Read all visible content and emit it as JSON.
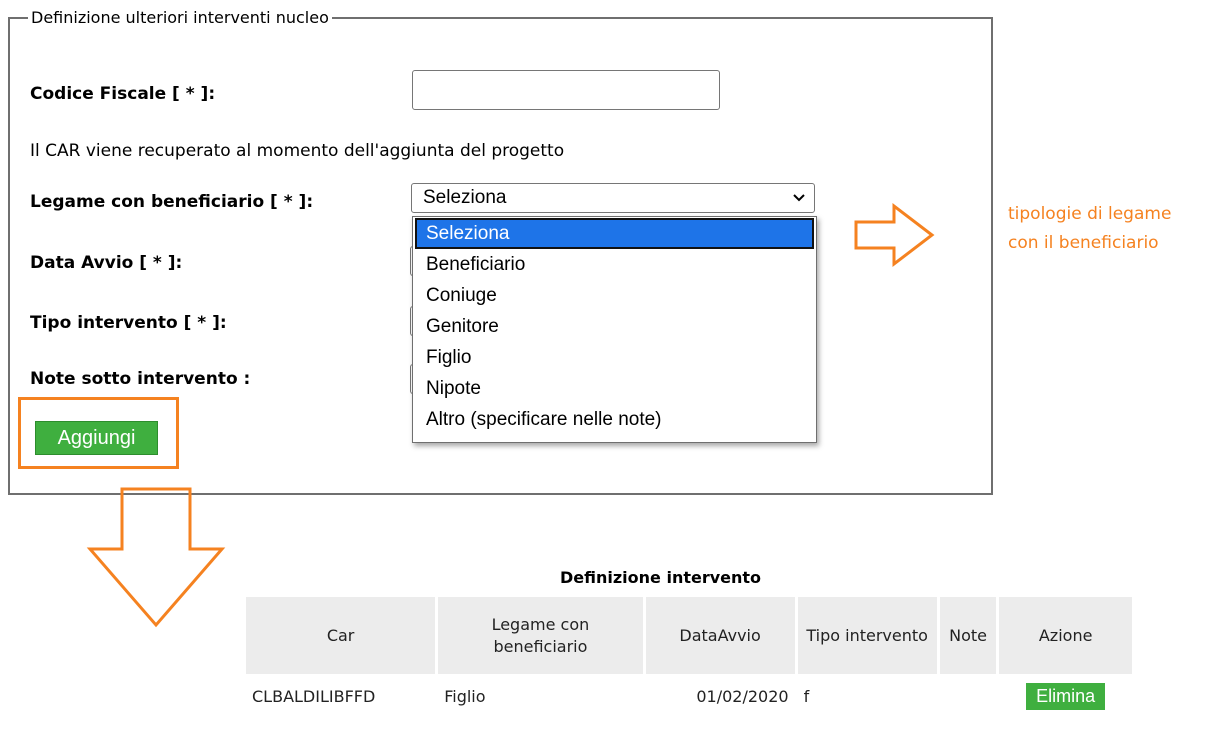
{
  "form": {
    "legend": "Definizione ulteriori interventi nucleo",
    "codice_fiscale_label": "Codice Fiscale [ * ]:",
    "codice_fiscale_value": "",
    "car_info": "Il CAR viene recuperato al momento dell'aggiunta del progetto",
    "legame_label": "Legame con beneficiario [ * ]:",
    "legame_selected": "Seleziona",
    "data_avvio_label": "Data Avvio [ * ]:",
    "tipo_intervento_label": "Tipo intervento [ * ]:",
    "note_label": "Note sotto intervento :",
    "add_button": "Aggiungi"
  },
  "dropdown": {
    "options": [
      "Seleziona",
      "Beneficiario",
      "Coniuge",
      "Genitore",
      "Figlio",
      "Nipote",
      "Altro (specificare nelle note)"
    ],
    "highlighted_index": 0
  },
  "annotation": {
    "line1": "tipologie di legame",
    "line2": "con il beneficiario",
    "color": "#f58220"
  },
  "table": {
    "title": "Definizione intervento",
    "headers": [
      "Car",
      "Legame con beneficiario",
      "DataAvvio",
      "Tipo intervento",
      "Note",
      "Azione"
    ],
    "rows": [
      {
        "car": "CLBALDILIBFFD",
        "legame": "Figlio",
        "data_avvio": "01/02/2020",
        "tipo": "f",
        "note": "",
        "azione": "Elimina"
      }
    ]
  },
  "colors": {
    "button_green": "#3faf3f",
    "selection_blue": "#1e74e8",
    "annotation_orange": "#f58220",
    "header_gray": "#ececec"
  }
}
